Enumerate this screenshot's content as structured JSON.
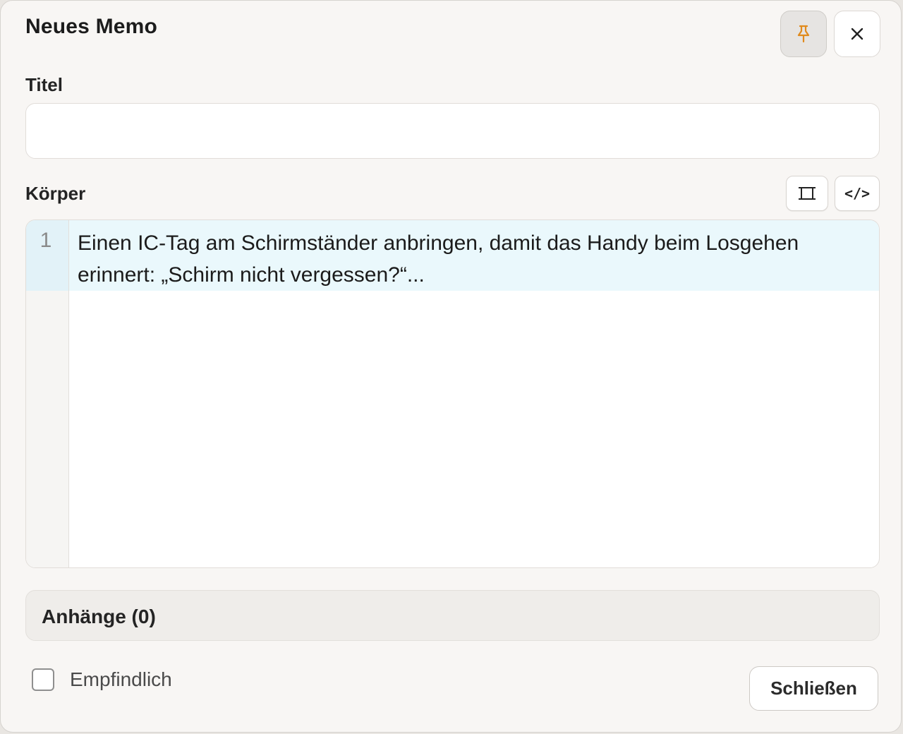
{
  "dialog": {
    "title": "Neues Memo",
    "pin_icon": "pin-icon",
    "close_icon": "close-icon",
    "accent_color": "#e08a1c"
  },
  "fields": {
    "title_label": "Titel",
    "title_value": "",
    "body_label": "Körper",
    "expand_icon": "expand-icon",
    "code_toggle_label": "</>"
  },
  "editor": {
    "line_number": "1",
    "line_text": "Einen IC-Tag am Schirmständer anbringen, damit das Handy beim Losgehen erinnert: „Schirm nicht vergessen?“..."
  },
  "attachments": {
    "label": "Anhänge (0)"
  },
  "footer": {
    "sensitive_label": "Empfindlich",
    "sensitive_checked": false,
    "close_button_label": "Schließen"
  }
}
